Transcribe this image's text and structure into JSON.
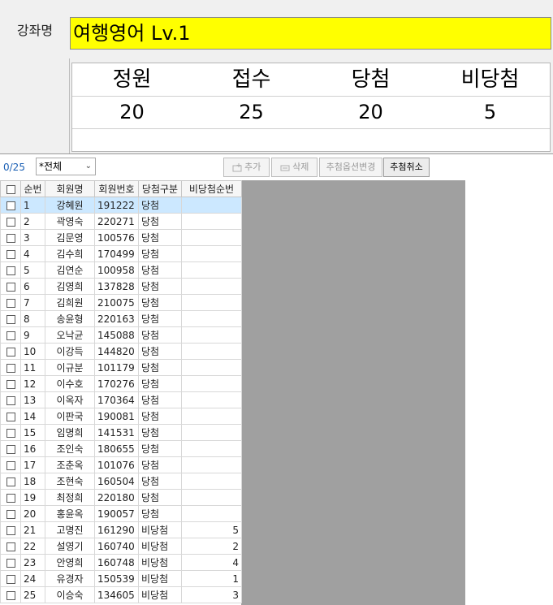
{
  "course": {
    "label": "강좌명",
    "value": "여행영어 Lv.1"
  },
  "stats": {
    "headers": [
      "정원",
      "접수",
      "당첨",
      "비당첨"
    ],
    "values": [
      "20",
      "25",
      "20",
      "5"
    ]
  },
  "toolbar": {
    "count": "0/25",
    "filter": "*전체",
    "add": "추가",
    "delete": "삭제",
    "change_option": "추첨옵션변경",
    "cancel": "추첨취소"
  },
  "grid": {
    "columns": [
      "순번",
      "회원명",
      "회원번호",
      "당첨구분",
      "비당첨순번"
    ],
    "rows": [
      {
        "no": "1",
        "name": "강혜원",
        "id": "191222",
        "status": "당첨",
        "rank": ""
      },
      {
        "no": "2",
        "name": "곽영숙",
        "id": "220271",
        "status": "당첨",
        "rank": ""
      },
      {
        "no": "3",
        "name": "김문영",
        "id": "100576",
        "status": "당첨",
        "rank": ""
      },
      {
        "no": "4",
        "name": "김수희",
        "id": "170499",
        "status": "당첨",
        "rank": ""
      },
      {
        "no": "5",
        "name": "김연순",
        "id": "100958",
        "status": "당첨",
        "rank": ""
      },
      {
        "no": "6",
        "name": "김영희",
        "id": "137828",
        "status": "당첨",
        "rank": ""
      },
      {
        "no": "7",
        "name": "김희원",
        "id": "210075",
        "status": "당첨",
        "rank": ""
      },
      {
        "no": "8",
        "name": "송윤형",
        "id": "220163",
        "status": "당첨",
        "rank": ""
      },
      {
        "no": "9",
        "name": "오낙균",
        "id": "145088",
        "status": "당첨",
        "rank": ""
      },
      {
        "no": "10",
        "name": "이강득",
        "id": "144820",
        "status": "당첨",
        "rank": ""
      },
      {
        "no": "11",
        "name": "이규분",
        "id": "101179",
        "status": "당첨",
        "rank": ""
      },
      {
        "no": "12",
        "name": "이수호",
        "id": "170276",
        "status": "당첨",
        "rank": ""
      },
      {
        "no": "13",
        "name": "이옥자",
        "id": "170364",
        "status": "당첨",
        "rank": ""
      },
      {
        "no": "14",
        "name": "이판국",
        "id": "190081",
        "status": "당첨",
        "rank": ""
      },
      {
        "no": "15",
        "name": "임명희",
        "id": "141531",
        "status": "당첨",
        "rank": ""
      },
      {
        "no": "16",
        "name": "조인숙",
        "id": "180655",
        "status": "당첨",
        "rank": ""
      },
      {
        "no": "17",
        "name": "조춘옥",
        "id": "101076",
        "status": "당첨",
        "rank": ""
      },
      {
        "no": "18",
        "name": "조현숙",
        "id": "160504",
        "status": "당첨",
        "rank": ""
      },
      {
        "no": "19",
        "name": "최정희",
        "id": "220180",
        "status": "당첨",
        "rank": ""
      },
      {
        "no": "20",
        "name": "홍윤옥",
        "id": "190057",
        "status": "당첨",
        "rank": ""
      },
      {
        "no": "21",
        "name": "고명진",
        "id": "161290",
        "status": "비당첨",
        "rank": "5"
      },
      {
        "no": "22",
        "name": "설영기",
        "id": "160740",
        "status": "비당첨",
        "rank": "2"
      },
      {
        "no": "23",
        "name": "안영희",
        "id": "160748",
        "status": "비당첨",
        "rank": "4"
      },
      {
        "no": "24",
        "name": "유경자",
        "id": "150539",
        "status": "비당첨",
        "rank": "1"
      },
      {
        "no": "25",
        "name": "이승숙",
        "id": "134605",
        "status": "비당첨",
        "rank": "3"
      }
    ]
  },
  "colors": {
    "win": "#d40000",
    "lose": "#1a1ad4",
    "highlight": "#ffff00",
    "selected_row": "#cce8ff"
  }
}
